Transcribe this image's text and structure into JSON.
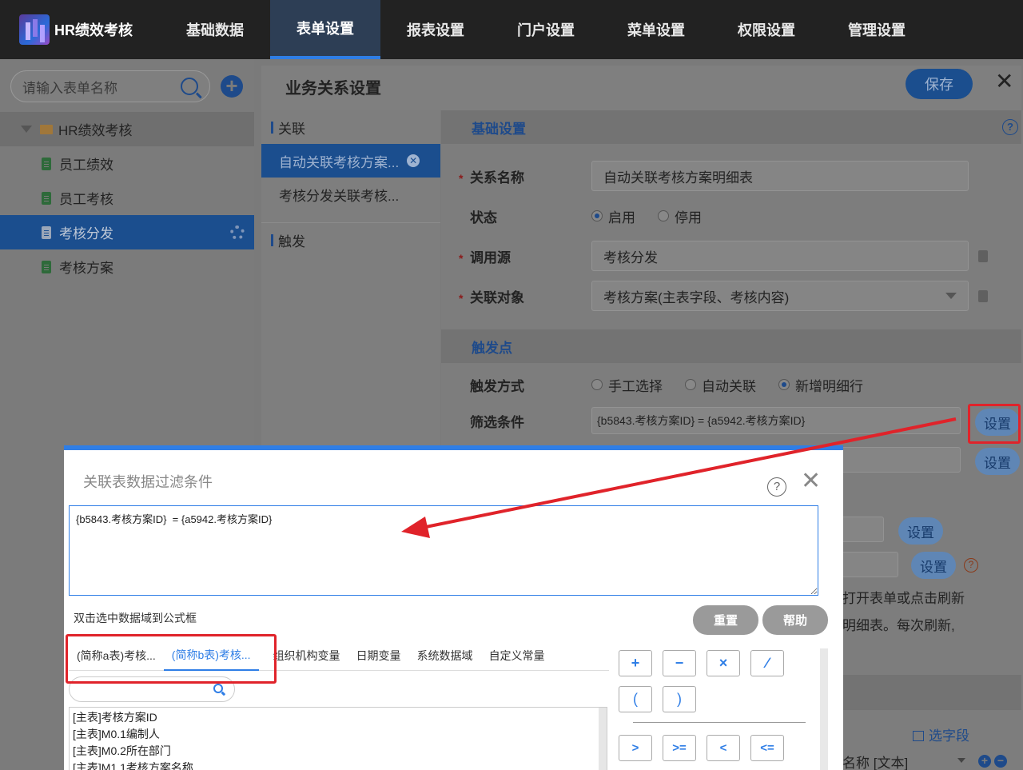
{
  "app": {
    "name": "HR绩效考核"
  },
  "nav": [
    "基础数据",
    "表单设置",
    "报表设置",
    "门户设置",
    "菜单设置",
    "权限设置",
    "管理设置"
  ],
  "sidebar": {
    "search_placeholder": "请输入表单名称",
    "root": "HR绩效考核",
    "items": [
      "员工绩效",
      "员工考核",
      "考核分发",
      "考核方案"
    ],
    "selected": "考核分发"
  },
  "main": {
    "title": "业务关系设置",
    "save_label": "保存",
    "relations": {
      "group_link": "关联",
      "items": [
        "自动关联考核方案...",
        "考核分发关联考核..."
      ],
      "group_trigger": "触发"
    },
    "basic": {
      "section": "基础设置",
      "name_label": "关系名称",
      "name_value": "自动关联考核方案明细表",
      "status_label": "状态",
      "status_on": "启用",
      "status_off": "停用",
      "source_label": "调用源",
      "source_value": "考核分发",
      "target_label": "关联对象",
      "target_value": "考核方案(主表字段、考核内容)"
    },
    "trigger": {
      "section": "触发点",
      "mode_label": "触发方式",
      "mode_manual": "手工选择",
      "mode_auto": "自动关联",
      "mode_add": "新增明细行",
      "filter_label": "筛选条件",
      "filter_value": "{b5843.考核方案ID}  = {a5942.考核方案ID}",
      "set_label": "设置"
    },
    "partial_text_1": "打开表单或点击刷新",
    "partial_text_2": "明细表。每次刷新,",
    "select_field": "选字段",
    "partial_field": "名称 [文本]"
  },
  "dialog": {
    "title": "关联表数据过滤条件",
    "formula": "{b5843.考核方案ID}  = {a5942.考核方案ID}",
    "hint": "双击选中数据域到公式框",
    "reset": "重置",
    "help": "帮助",
    "tabs": [
      "(简称a表)考核...",
      "(简称b表)考核...",
      "组织机构变量",
      "日期变量",
      "系统数据域",
      "自定义常量"
    ],
    "active_tab": 1,
    "fields": [
      "[主表]考核方案ID",
      "[主表]M0.1编制人",
      "[主表]M0.2所在部门",
      "[主表]M1.1考核方案名称"
    ],
    "operators": [
      "+",
      "−",
      "×",
      "∕",
      "(",
      ")",
      ">",
      ">=",
      "<",
      "<="
    ]
  },
  "colors": {
    "accent": "#2f7ee6",
    "annotation_red": "#e0232a",
    "nav_bg": "#222222"
  }
}
